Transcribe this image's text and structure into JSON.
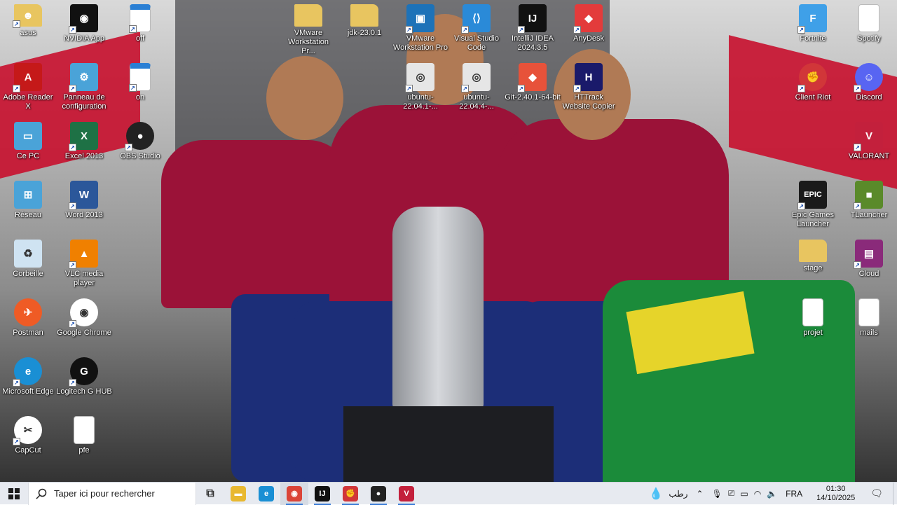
{
  "desktop_icons": [
    {
      "label": "asus",
      "icon": "folder-user-icon",
      "color": "#e8c560"
    },
    {
      "label": "NVIDIA App",
      "icon": "nvidia-icon",
      "color": "#111111"
    },
    {
      "label": "off",
      "icon": "window-icon",
      "color": "#ffffff"
    },
    {
      "label": "VMware Workstation Pr...",
      "icon": "folder-icon",
      "color": "#e8c560"
    },
    {
      "label": "jdk-23.0.1",
      "icon": "folder-icon",
      "color": "#e8c560"
    },
    {
      "label": "VMware Workstation Pro",
      "icon": "vmware-icon",
      "color": "#1d72b8"
    },
    {
      "label": "Visual Studio Code",
      "icon": "vscode-icon",
      "color": "#2a8ad8"
    },
    {
      "label": "IntelliJ IDEA 2024.3.5",
      "icon": "intellij-icon",
      "color": "#111111"
    },
    {
      "label": "AnyDesk",
      "icon": "anydesk-icon",
      "color": "#e33b3b"
    },
    {
      "label": "Fortnite",
      "icon": "fortnite-icon",
      "color": "#3fa0e8"
    },
    {
      "label": "Spotify",
      "icon": "file-icon",
      "color": "#ffffff"
    },
    {
      "label": "Adobe Reader X",
      "icon": "adobe-icon",
      "color": "#c51919"
    },
    {
      "label": "Panneau de configuration",
      "icon": "control-panel-icon",
      "color": "#4aa3d8"
    },
    {
      "label": "on",
      "icon": "window-icon",
      "color": "#ffffff"
    },
    {
      "label": "ubuntu-22.04.1-...",
      "icon": "disc-icon",
      "color": "#e6e6e6"
    },
    {
      "label": "ubuntu-22.04.4-...",
      "icon": "disc-icon",
      "color": "#e6e6e6"
    },
    {
      "label": "Git-2.40.1-64-bit",
      "icon": "git-icon",
      "color": "#e7523a"
    },
    {
      "label": "HTTrack Website Copier",
      "icon": "httrack-icon",
      "color": "#1a1a6a"
    },
    {
      "label": "Client Riot",
      "icon": "riot-icon",
      "color": "#d13639"
    },
    {
      "label": "Discord",
      "icon": "discord-icon",
      "color": "#5865f2"
    },
    {
      "label": "Ce PC",
      "icon": "computer-icon",
      "color": "#4aa3d8"
    },
    {
      "label": "Excel 2013",
      "icon": "excel-icon",
      "color": "#1e7145"
    },
    {
      "label": "OBS Studio",
      "icon": "obs-icon",
      "color": "#222222"
    },
    {
      "label": "VALORANT",
      "icon": "valorant-icon",
      "color": "#c3203c"
    },
    {
      "label": "Réseau",
      "icon": "network-icon",
      "color": "#4aa3d8"
    },
    {
      "label": "Word 2013",
      "icon": "word-icon",
      "color": "#2b579a"
    },
    {
      "label": "Epic Games Launcher",
      "icon": "epic-icon",
      "color": "#1a1a1a"
    },
    {
      "label": "TLauncher",
      "icon": "minecraft-icon",
      "color": "#5a8a2a"
    },
    {
      "label": "Corbeille",
      "icon": "recycle-bin-icon",
      "color": "#cfe3f2"
    },
    {
      "label": "VLC media player",
      "icon": "vlc-icon",
      "color": "#f08000"
    },
    {
      "label": "stage",
      "icon": "zip-folder-icon",
      "color": "#e8c560"
    },
    {
      "label": "Cloud",
      "icon": "winrar-icon",
      "color": "#8a2a7a"
    },
    {
      "label": "Postman",
      "icon": "postman-icon",
      "color": "#ef5b25"
    },
    {
      "label": "Google Chrome",
      "icon": "chrome-icon",
      "color": "#ffffff"
    },
    {
      "label": "projet",
      "icon": "file-icon",
      "color": "#ffffff"
    },
    {
      "label": "mails",
      "icon": "file-icon",
      "color": "#ffffff"
    },
    {
      "label": "Microsoft Edge",
      "icon": "edge-icon",
      "color": "#1a8fd4"
    },
    {
      "label": "Logitech G HUB",
      "icon": "logitech-icon",
      "color": "#111111"
    },
    {
      "label": "CapCut",
      "icon": "capcut-icon",
      "color": "#ffffff"
    },
    {
      "label": "pfe",
      "icon": "file-icon",
      "color": "#ffffff"
    }
  ],
  "taskbar": {
    "search_placeholder": "Taper ici pour rechercher",
    "apps": [
      {
        "name": "task-view-icon",
        "glyph": "⧉"
      },
      {
        "name": "file-explorer-icon",
        "glyph": "▬"
      },
      {
        "name": "edge-icon",
        "glyph": "e"
      },
      {
        "name": "chrome-icon",
        "glyph": "◉"
      },
      {
        "name": "intellij-icon",
        "glyph": "IJ"
      },
      {
        "name": "riot-icon",
        "glyph": "✊"
      },
      {
        "name": "obs-icon",
        "glyph": "●"
      },
      {
        "name": "valorant-icon",
        "glyph": "V"
      }
    ],
    "weather": "رطب",
    "language": "FRA",
    "time": "01:30",
    "date": "14/10/2025"
  }
}
